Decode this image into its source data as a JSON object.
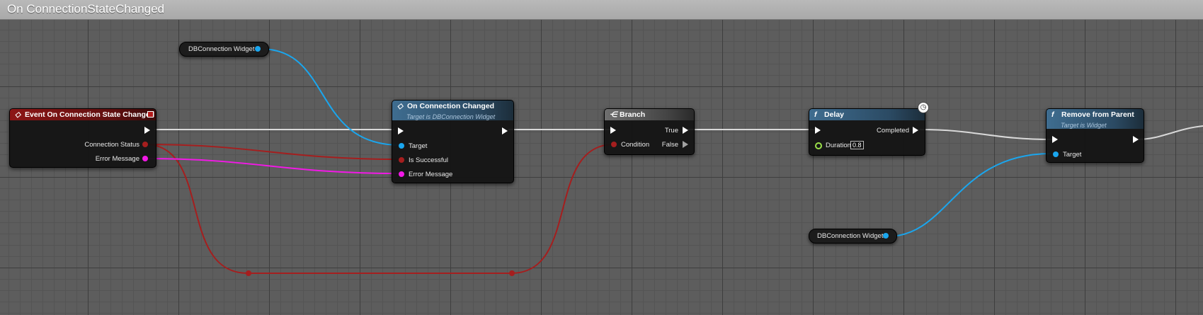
{
  "graph": {
    "title": "On ConnectionStateChanged"
  },
  "event_node": {
    "title": "Event On Connection State Changed",
    "pins": {
      "connection_status": "Connection Status",
      "error_message": "Error Message"
    }
  },
  "var_node_top": {
    "label": "DBConnection Widget"
  },
  "var_node_bottom": {
    "label": "DBConnection Widget"
  },
  "call_node": {
    "title": "On Connection Changed",
    "subtitle": "Target is DBConnection Widget",
    "pins": {
      "target": "Target",
      "is_successful": "Is Successful",
      "error_message": "Error Message"
    }
  },
  "branch_node": {
    "title": "Branch",
    "pins": {
      "condition": "Condition",
      "true": "True",
      "false": "False"
    }
  },
  "delay_node": {
    "title": "Delay",
    "icon": "f",
    "pins": {
      "completed": "Completed",
      "duration": "Duration"
    },
    "duration_value": "0.8"
  },
  "remove_node": {
    "title": "Remove from Parent",
    "icon": "f",
    "subtitle": "Target is Widget",
    "pins": {
      "target": "Target"
    }
  },
  "colors": {
    "exec_wire": "#ffffff",
    "object_pin": "#1aa6ee",
    "bool_pin": "#a51e1e",
    "string_pin": "#f219e6",
    "float_pin": "#9be04a"
  }
}
